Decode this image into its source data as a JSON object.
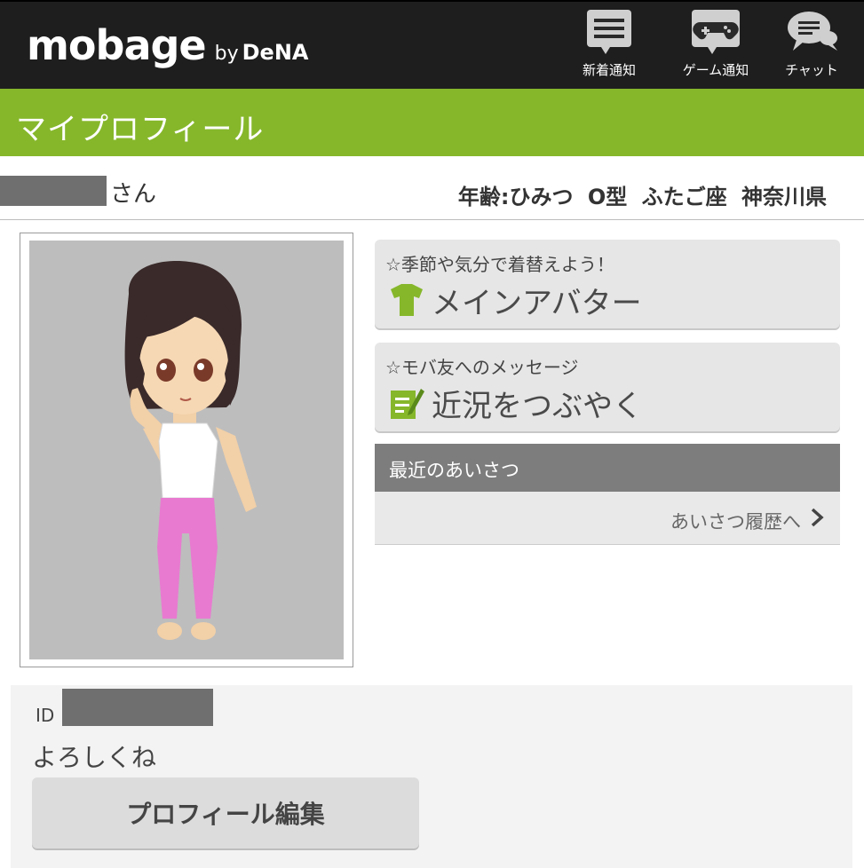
{
  "header": {
    "logo_main": "mobage",
    "logo_by": "by",
    "logo_brand": "DeNA",
    "nav": [
      {
        "label": "新着通知",
        "icon": "news-list-icon"
      },
      {
        "label": "ゲーム通知",
        "icon": "gamepad-icon"
      },
      {
        "label": "チャット",
        "icon": "chat-bubbles-icon"
      }
    ]
  },
  "title": "マイプロフィール",
  "profile": {
    "name_suffix": "さん",
    "info": "年齢:ひみつ O型 ふたご座 神奈川県",
    "id_label": "ID",
    "comment": "よろしくね",
    "edit_button": "プロフィール編集"
  },
  "cards": {
    "avatar_sub": "☆季節や気分で着替えよう！",
    "avatar_main": "メインアバター",
    "tweet_sub": "☆モバ友へのメッセージ",
    "tweet_main": "近況をつぶやく"
  },
  "greetings": {
    "header": "最近のあいさつ",
    "link": "あいさつ履歴へ"
  },
  "colors": {
    "header_bg": "#1e1e1e",
    "accent_green": "#86b72b",
    "card_bg": "#e6e6e6"
  }
}
